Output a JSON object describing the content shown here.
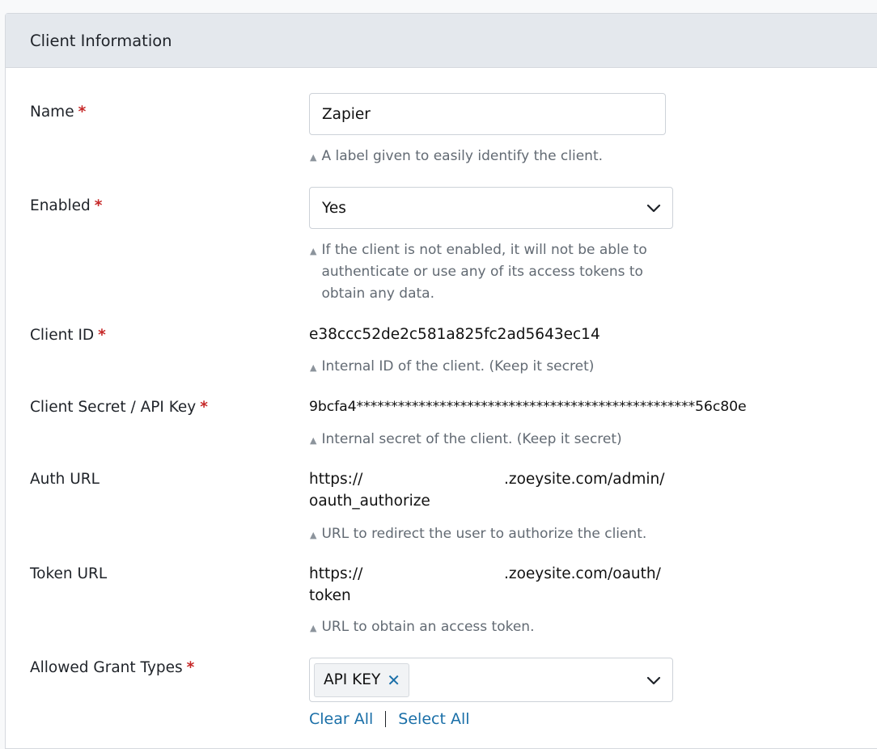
{
  "panel": {
    "title": "Client Information"
  },
  "fields": {
    "name": {
      "label": "Name",
      "required_mark": "*",
      "value": "Zapier",
      "hint": "A label given to easily identify the client."
    },
    "enabled": {
      "label": "Enabled",
      "required_mark": "*",
      "value": "Yes",
      "hint_lines": [
        "If the client is not enabled, it will not be able to",
        "authenticate or use any of its access tokens to",
        "obtain any data."
      ]
    },
    "client_id": {
      "label": "Client ID",
      "required_mark": "*",
      "value": "e38ccc52de2c581a825fc2ad5643ec14",
      "hint": "Internal ID of the client. (Keep it secret)"
    },
    "client_secret": {
      "label": "Client Secret / API Key",
      "required_mark": "*",
      "value": "9bcfa4*************************************************56c80e",
      "hint": "Internal secret of the client. (Keep it secret)"
    },
    "auth_url": {
      "label": "Auth URL",
      "value_line1_start": "https://",
      "value_line1_end": ".zoeysite.com/admin/",
      "value_line2": "oauth_authorize",
      "hint": "URL to redirect the user to authorize the client."
    },
    "token_url": {
      "label": "Token URL",
      "value_line1_start": "https://",
      "value_line1_end": ".zoeysite.com/oauth/",
      "value_line2": "token",
      "hint": "URL to obtain an access token."
    },
    "grant_types": {
      "label": "Allowed Grant Types",
      "required_mark": "*",
      "selected_tags": [
        "API KEY"
      ],
      "tag_remove_glyph": "✕",
      "clear_all": "Clear All",
      "select_all": "Select All"
    }
  },
  "icons": {
    "hint_marker": "▲",
    "chevron": "chevron-down-icon"
  },
  "colors": {
    "required": "#c62828",
    "link": "#1a6fa8",
    "header_bg": "#e4e8ed"
  }
}
